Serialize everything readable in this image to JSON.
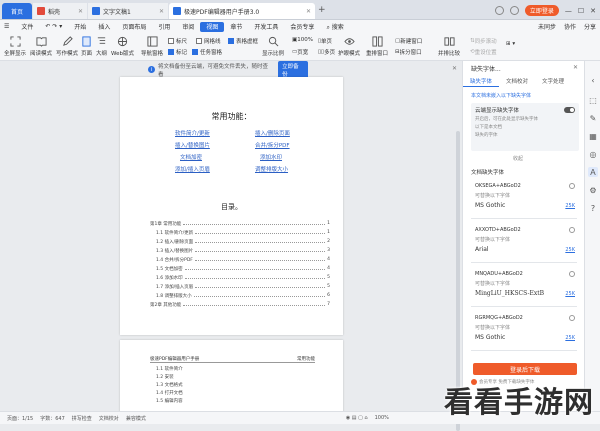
{
  "titlebar": {
    "tabs": [
      {
        "label": "首页",
        "icon": "home-icon"
      },
      {
        "label": "稻壳",
        "icon": "docer-icon"
      },
      {
        "label": "文字文稿1",
        "icon": "word-doc-icon"
      },
      {
        "label": "极速PDF编辑器用户手册3.0",
        "icon": "word-doc-icon"
      }
    ],
    "new_tab": "+",
    "login_label": "立即登录"
  },
  "menubar": {
    "file_label": "文件",
    "items": [
      "开始",
      "插入",
      "页面布局",
      "引用",
      "审阅",
      "视图",
      "章节",
      "开发工具",
      "会员专享",
      "搜索"
    ],
    "active": "视图",
    "right": [
      "未同步",
      "协作",
      "分享"
    ]
  },
  "ribbon": {
    "buttons": [
      "全屏显示",
      "阅读模式",
      "写作模式",
      "页面",
      "大纲",
      "Web版式",
      "导航窗格",
      "显示比例",
      "100%",
      "单页",
      "多页",
      "护眼模式",
      "重排窗口",
      "拆分窗口",
      "并排比较"
    ],
    "checkboxes": [
      {
        "label": "标尺",
        "checked": false
      },
      {
        "label": "网格线",
        "checked": false
      },
      {
        "label": "标记",
        "checked": true
      },
      {
        "label": "表格虚框",
        "checked": true
      },
      {
        "label": "任务窗格",
        "checked": true
      }
    ],
    "extra": [
      "页宽",
      "新建窗口",
      "同步滚动",
      "重设位置"
    ]
  },
  "notice": {
    "text": "将文档备份至云端，可避免文件丢失，随时查看",
    "button": "立即备份"
  },
  "document": {
    "page1_title": "常用功能：",
    "links": [
      "软件简介/更新",
      "插入/删除页面",
      "插入/替换图片",
      "合并/拆分PDF",
      "文档加密",
      "添加水印",
      "添加/插入页眉",
      "调整排版大小"
    ],
    "toc_title": "目录。",
    "toc": [
      {
        "label": "第1章 常用功能",
        "page": "1"
      },
      {
        "label": "1.1 软件简介/更新",
        "page": "1"
      },
      {
        "label": "1.2 插入/删除页面",
        "page": "2"
      },
      {
        "label": "1.3 插入/替换图片",
        "page": "3"
      },
      {
        "label": "1.4 合并/拆分PDF",
        "page": "4"
      },
      {
        "label": "1.5 文档加密",
        "page": "4"
      },
      {
        "label": "1.6 添加水印",
        "page": "5"
      },
      {
        "label": "1.7 添加/插入页眉",
        "page": "5"
      },
      {
        "label": "1.8 调整排版大小",
        "page": "6"
      },
      {
        "label": "第2章 其他功能",
        "page": "7"
      }
    ],
    "page2_header_left": "极速PDF编辑器用户手册",
    "page2_header_right": "常用功能",
    "page2_lines": [
      "1.1 软件简介",
      "1.2 安装",
      "1.3 文档格式",
      "1.4 打开文档",
      "1.5 编辑内容"
    ]
  },
  "sidebar": {
    "title": "缺失字体...",
    "tabs": [
      "缺失字体",
      "文档校对",
      "文字处理"
    ],
    "note": "本文档未嵌入以下缺失字体",
    "info_title": "云端显示缺失字体",
    "info_lines": [
      "开启后，可在此处显示缺失字体",
      "以下是本文档",
      "缺失的字体"
    ],
    "collapse": "收起",
    "subtitle": "文档缺失字体",
    "fonts": [
      {
        "code": "OKSEGA+ABGoD2",
        "desc": "可替换以下字体",
        "sample": "MS Gothic",
        "size": "25K"
      },
      {
        "code": "AXXOTD+ABGoD2",
        "desc": "可替换以下字体",
        "sample": "Arial",
        "size": "25K"
      },
      {
        "code": "MNQADU+ABGoD2",
        "desc": "可替换以下字体",
        "sample": "MingLiU_HKSCS-ExtB",
        "size": "25K"
      },
      {
        "code": "RGRMQG+ABGoD2",
        "desc": "可替换以下字体",
        "sample": "MS Gothic",
        "size": "25K"
      }
    ],
    "download_button": "登录后下载",
    "footer": "会员专享 免费下载缺失字体"
  },
  "statusbar": {
    "items": [
      "页面：1/15",
      "字数：647",
      "拼写检查",
      "文档校对",
      "兼容模式"
    ],
    "zoom": "100%"
  },
  "watermark": "看看手游网",
  "colors": {
    "accent": "#2b6fe0",
    "orange": "#ef5b2a"
  }
}
